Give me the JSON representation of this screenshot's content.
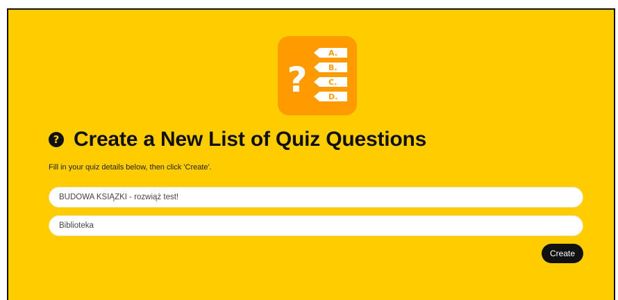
{
  "header": {
    "logo_letters": [
      "A.",
      "B.",
      "C.",
      "D."
    ],
    "logo_symbol": "?",
    "title": "Create a New List of Quiz Questions",
    "title_icon_glyph": "?",
    "subtitle": "Fill in your quiz details below, then click 'Create'."
  },
  "form": {
    "title_value": "BUDOWA KSIĄŻKI - rozwiąż test!",
    "description_value": "Biblioteka",
    "create_label": "Create"
  },
  "colors": {
    "background": "#ffcc00",
    "logo_tile": "#ff9a00",
    "button": "#111111",
    "field": "#ffffff"
  }
}
